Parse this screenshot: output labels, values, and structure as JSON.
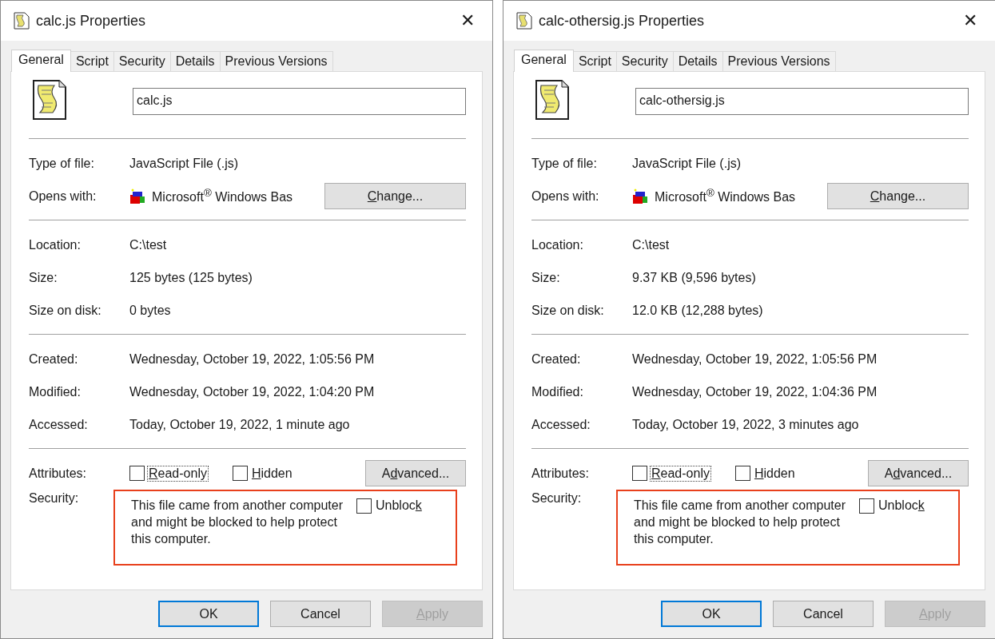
{
  "dialogs": [
    {
      "title": "calc.js Properties",
      "close": "✕",
      "tabs": [
        {
          "label": "General",
          "selected": true
        },
        {
          "label": "Script",
          "selected": false
        },
        {
          "label": "Security",
          "selected": false
        },
        {
          "label": "Details",
          "selected": false
        },
        {
          "label": "Previous Versions",
          "selected": false
        }
      ],
      "filename": "calc.js",
      "type": {
        "label": "Type of file:",
        "value": "JavaScript File (.js)"
      },
      "opens": {
        "label": "Opens with:",
        "value": "Microsoft$^{®}$ Windows Bas",
        "button": [
          {
            "text": "C",
            "underlined": true
          },
          {
            "text": "hange...",
            "underlined": false
          }
        ]
      },
      "groups": [
        [
          {
            "label": "Location:",
            "value": "C:\\test"
          },
          {
            "label": "Size:",
            "value": "125 bytes (125 bytes)"
          },
          {
            "label": "Size on disk:",
            "value": "0 bytes"
          }
        ],
        [
          {
            "label": "Created:",
            "value": "Wednesday, October 19, 2022, 1:05:56 PM"
          },
          {
            "label": "Modified:",
            "value": "Wednesday, October 19, 2022, 1:04:20 PM"
          },
          {
            "label": "Accessed:",
            "value": "Today, October 19, 2022, 1 minute ago"
          }
        ]
      ],
      "attributes_label": "Attributes:",
      "attributes": [
        {
          "label": [
            {
              "text": "R",
              "underlined": true
            },
            {
              "text": "ead-only",
              "underlined": false
            }
          ],
          "checked": false,
          "focused": true
        },
        {
          "label": [
            {
              "text": "H",
              "underlined": true
            },
            {
              "text": "idden",
              "underlined": false
            }
          ],
          "checked": false,
          "focused": false
        }
      ],
      "advanced": [
        {
          "text": "A",
          "underlined": false
        },
        {
          "text": "d",
          "underlined": true
        },
        {
          "text": "vanced...",
          "underlined": false
        }
      ],
      "security_label": "Security:",
      "security_text": "This file came from another computer and might be blocked to help protect this computer.",
      "unblock": {
        "label": [
          {
            "text": "Unbloc",
            "underlined": false
          },
          {
            "text": "k",
            "underlined": true
          }
        ],
        "checked": false
      },
      "highlighted": true,
      "buttons": [
        {
          "label": [
            {
              "text": "OK",
              "underlined": false
            }
          ],
          "default": true,
          "disabled": false
        },
        {
          "label": [
            {
              "text": "Cancel",
              "underlined": false
            }
          ],
          "default": false,
          "disabled": false
        },
        {
          "label": [
            {
              "text": "A",
              "underlined": true
            },
            {
              "text": "pply",
              "underlined": false
            }
          ],
          "default": false,
          "disabled": true
        }
      ]
    },
    {
      "title": "calc-othersig.js Properties",
      "close": "✕",
      "tabs": [
        {
          "label": "General",
          "selected": true
        },
        {
          "label": "Script",
          "selected": false
        },
        {
          "label": "Security",
          "selected": false
        },
        {
          "label": "Details",
          "selected": false
        },
        {
          "label": "Previous Versions",
          "selected": false
        }
      ],
      "filename": "calc-othersig.js",
      "type": {
        "label": "Type of file:",
        "value": "JavaScript File (.js)"
      },
      "opens": {
        "label": "Opens with:",
        "value": "Microsoft$^{®}$ Windows Bas",
        "button": [
          {
            "text": "C",
            "underlined": true
          },
          {
            "text": "hange...",
            "underlined": false
          }
        ]
      },
      "groups": [
        [
          {
            "label": "Location:",
            "value": "C:\\test"
          },
          {
            "label": "Size:",
            "value": "9.37 KB (9,596 bytes)"
          },
          {
            "label": "Size on disk:",
            "value": "12.0 KB (12,288 bytes)"
          }
        ],
        [
          {
            "label": "Created:",
            "value": "Wednesday, October 19, 2022, 1:05:56 PM"
          },
          {
            "label": "Modified:",
            "value": "Wednesday, October 19, 2022, 1:04:36 PM"
          },
          {
            "label": "Accessed:",
            "value": "Today, October 19, 2022, 3 minutes ago"
          }
        ]
      ],
      "attributes_label": "Attributes:",
      "attributes": [
        {
          "label": [
            {
              "text": "R",
              "underlined": true
            },
            {
              "text": "ead-only",
              "underlined": false
            }
          ],
          "checked": false,
          "focused": true
        },
        {
          "label": [
            {
              "text": "H",
              "underlined": true
            },
            {
              "text": "idden",
              "underlined": false
            }
          ],
          "checked": false,
          "focused": false
        }
      ],
      "advanced": [
        {
          "text": "A",
          "underlined": false
        },
        {
          "text": "d",
          "underlined": true
        },
        {
          "text": "vanced...",
          "underlined": false
        }
      ],
      "security_label": "Security:",
      "security_text": "This file came from another computer and might be blocked to help protect this computer.",
      "unblock": {
        "label": [
          {
            "text": "Unbloc",
            "underlined": false
          },
          {
            "text": "k",
            "underlined": true
          }
        ],
        "checked": false
      },
      "highlighted": true,
      "buttons": [
        {
          "label": [
            {
              "text": "OK",
              "underlined": false
            }
          ],
          "default": true,
          "disabled": false
        },
        {
          "label": [
            {
              "text": "Cancel",
              "underlined": false
            }
          ],
          "default": false,
          "disabled": false
        },
        {
          "label": [
            {
              "text": "A",
              "underlined": true
            },
            {
              "text": "pply",
              "underlined": false
            }
          ],
          "default": false,
          "disabled": true
        }
      ]
    }
  ]
}
